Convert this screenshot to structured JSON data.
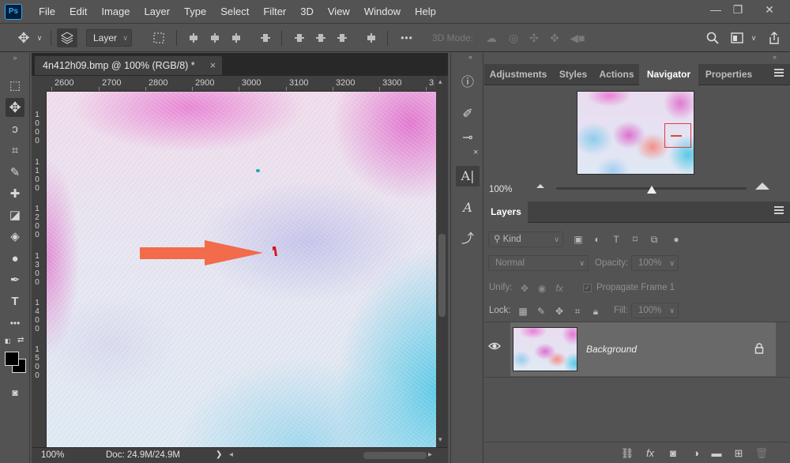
{
  "app": {
    "logo": "Ps"
  },
  "menu": [
    "File",
    "Edit",
    "Image",
    "Layer",
    "Type",
    "Select",
    "Filter",
    "3D",
    "View",
    "Window",
    "Help"
  ],
  "window_controls": {
    "minimize": "—",
    "restore": "❐",
    "close": "✕"
  },
  "options": {
    "move_icon": "move-tool-icon",
    "auto_select_value": "Layer",
    "mode3d_label": "3D Mode:",
    "more": "•••"
  },
  "document": {
    "tab_title": "4n412h09.bmp @ 100% (RGB/8) *",
    "tab_close": "×",
    "ruler_h_ticks": [
      "2600",
      "2700",
      "2800",
      "2900",
      "3000",
      "3100",
      "3200",
      "3300",
      "3"
    ],
    "ruler_v_labels": [
      "1\n0\n0\n0",
      "1\n1\n0\n0",
      "1\n2\n0\n0",
      "1\n3\n0\n0",
      "1\n4\n0\n0",
      "1\n5\n0\n0"
    ],
    "status_zoom": "100%",
    "status_doc": "Doc: 24.9M/24.9M",
    "status_arrow": "❯",
    "annotation_arrow_color": "#f26b4a",
    "annotation_mark_color": "#d4141e"
  },
  "navigator": {
    "tabs": [
      "Adjustments",
      "Styles",
      "Actions",
      "Navigator",
      "Properties"
    ],
    "active_tab": "Navigator",
    "zoom": "100%",
    "view_rect_color": "#e23a3a"
  },
  "layers": {
    "tab": "Layers",
    "kind_label": "Kind",
    "blend_mode": "Normal",
    "opacity_label": "Opacity:",
    "opacity_value": "100%",
    "unify_label": "Unify:",
    "propagate_label": "Propagate Frame 1",
    "lock_label": "Lock:",
    "fill_label": "Fill:",
    "fill_value": "100%",
    "items": [
      {
        "name": "Background",
        "visible": true,
        "locked": true
      }
    ],
    "bottom_icons": [
      "link-icon",
      "fx-icon",
      "mask-icon",
      "adjustment-icon",
      "folder-icon",
      "new-layer-icon",
      "trash-icon"
    ]
  },
  "colors": {
    "accent": "#31a8ff",
    "panel": "#535353",
    "dark": "#404040",
    "selected_row": "#696969"
  }
}
